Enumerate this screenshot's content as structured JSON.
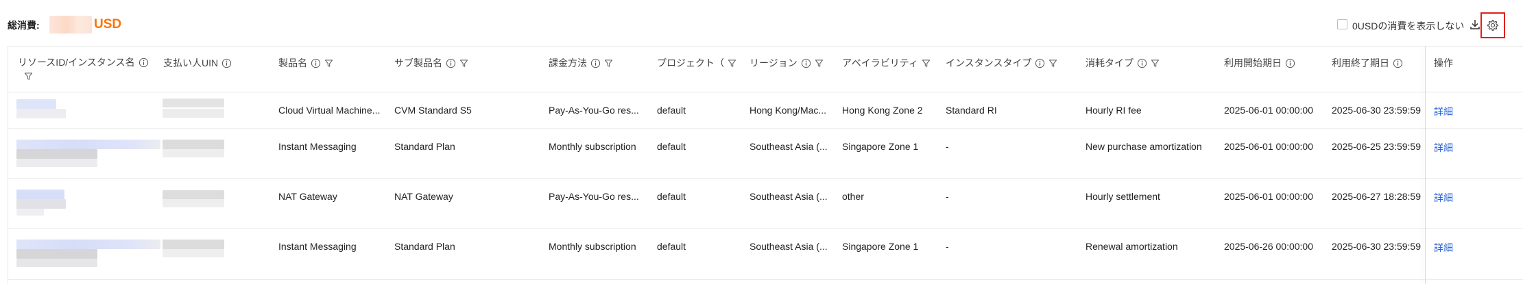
{
  "summary": {
    "total_label": "総消費:",
    "currency": "USD",
    "hide_zero_label": "0USDの消費を表示しない"
  },
  "icons": {
    "info": "info-circle-icon",
    "filter": "filter-icon",
    "download": "download-icon",
    "settings": "gear-icon"
  },
  "colors": {
    "accent_orange": "#ff7200",
    "link_blue": "#2a65d9",
    "highlight_red": "#e0201c"
  },
  "table": {
    "columns": [
      {
        "label": "リソースID/インスタンス名"
      },
      {
        "label": "支払い人UIN"
      },
      {
        "label": "製品名"
      },
      {
        "label": "サブ製品名"
      },
      {
        "label": "課金方法"
      },
      {
        "label": "プロジェクト（"
      },
      {
        "label": "リージョン"
      },
      {
        "label": "アベイラビリティ"
      },
      {
        "label": "インスタンスタイプ"
      },
      {
        "label": "消耗タイプ"
      },
      {
        "label": "利用開始期日"
      },
      {
        "label": "利用終了期日"
      },
      {
        "label": "操作"
      }
    ],
    "rows": [
      {
        "product": "Cloud Virtual Machine...",
        "sub_product": "CVM Standard S5",
        "billing": "Pay-As-You-Go res...",
        "project": "default",
        "region": "Hong Kong/Mac...",
        "zone": "Hong Kong Zone 2",
        "instance_type": "Standard RI",
        "consumption_type": "Hourly RI fee",
        "start": "2025-06-01 00:00:00",
        "end": "2025-06-30 23:59:59",
        "action": "詳細"
      },
      {
        "product": "Instant Messaging",
        "sub_product": "Standard Plan",
        "billing": "Monthly subscription",
        "project": "default",
        "region": "Southeast Asia (...",
        "zone": "Singapore Zone 1",
        "instance_type": "-",
        "consumption_type": "New purchase amortization",
        "start": "2025-06-01 00:00:00",
        "end": "2025-06-25 23:59:59",
        "action": "詳細"
      },
      {
        "product": "NAT Gateway",
        "sub_product": "NAT Gateway",
        "billing": "Pay-As-You-Go res...",
        "project": "default",
        "region": "Southeast Asia (...",
        "zone": "other",
        "instance_type": "-",
        "consumption_type": "Hourly settlement",
        "start": "2025-06-01 00:00:00",
        "end": "2025-06-27 18:28:59",
        "action": "詳細"
      },
      {
        "product": "Instant Messaging",
        "sub_product": "Standard Plan",
        "billing": "Monthly subscription",
        "project": "default",
        "region": "Southeast Asia (...",
        "zone": "Singapore Zone 1",
        "instance_type": "-",
        "consumption_type": "Renewal amortization",
        "start": "2025-06-26 00:00:00",
        "end": "2025-06-30 23:59:59",
        "action": "詳細"
      }
    ]
  }
}
